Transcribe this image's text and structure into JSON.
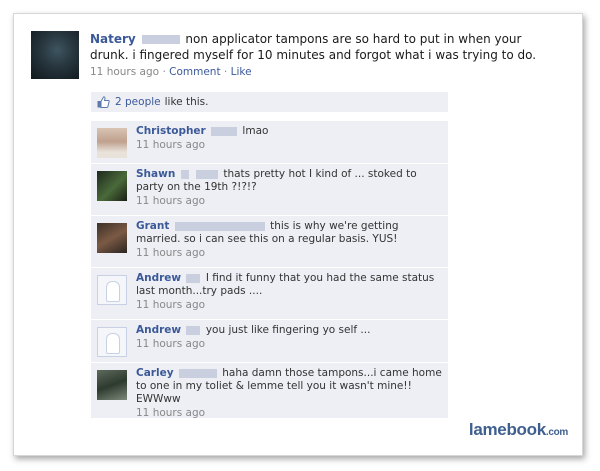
{
  "post": {
    "author": "Natery",
    "text": "non applicator tampons are so hard to put in when your drunk. i fingered myself for 10 minutes and forgot what i was trying to do.",
    "time": "11 hours ago",
    "sep1": "·",
    "comment_link": "Comment",
    "sep2": "·",
    "like_link": "Like"
  },
  "likes": {
    "count_text": "2 people",
    "suffix": "like this."
  },
  "comments": [
    {
      "name": "Christopher",
      "text": "lmao",
      "time": "11 hours ago"
    },
    {
      "name": "Shawn",
      "text": "thats pretty hot I kind of ... stoked to party on the 19th ?!?!?",
      "time": "11 hours ago"
    },
    {
      "name": "Grant",
      "text": "this is why we're getting married. so i can see this on a regular basis. YUS!",
      "time": "11 hours ago"
    },
    {
      "name": "Andrew",
      "text": "I find it funny that you had the same status last month...try pads ....",
      "time": "11 hours ago"
    },
    {
      "name": "Andrew",
      "text": "you just like fingering yo self ...",
      "time": "11 hours ago"
    },
    {
      "name": "Carley",
      "text": "haha damn those tampons...i came home to one in my toliet & lemme tell you it wasn't mine!! EWWww",
      "time": "11 hours ago"
    }
  ],
  "watermark": {
    "brand": "lamebook",
    "domain": ".com"
  },
  "colors": {
    "link": "#3b5998",
    "comment_bg": "#edeff4",
    "redaction": "#c9cfdf"
  }
}
